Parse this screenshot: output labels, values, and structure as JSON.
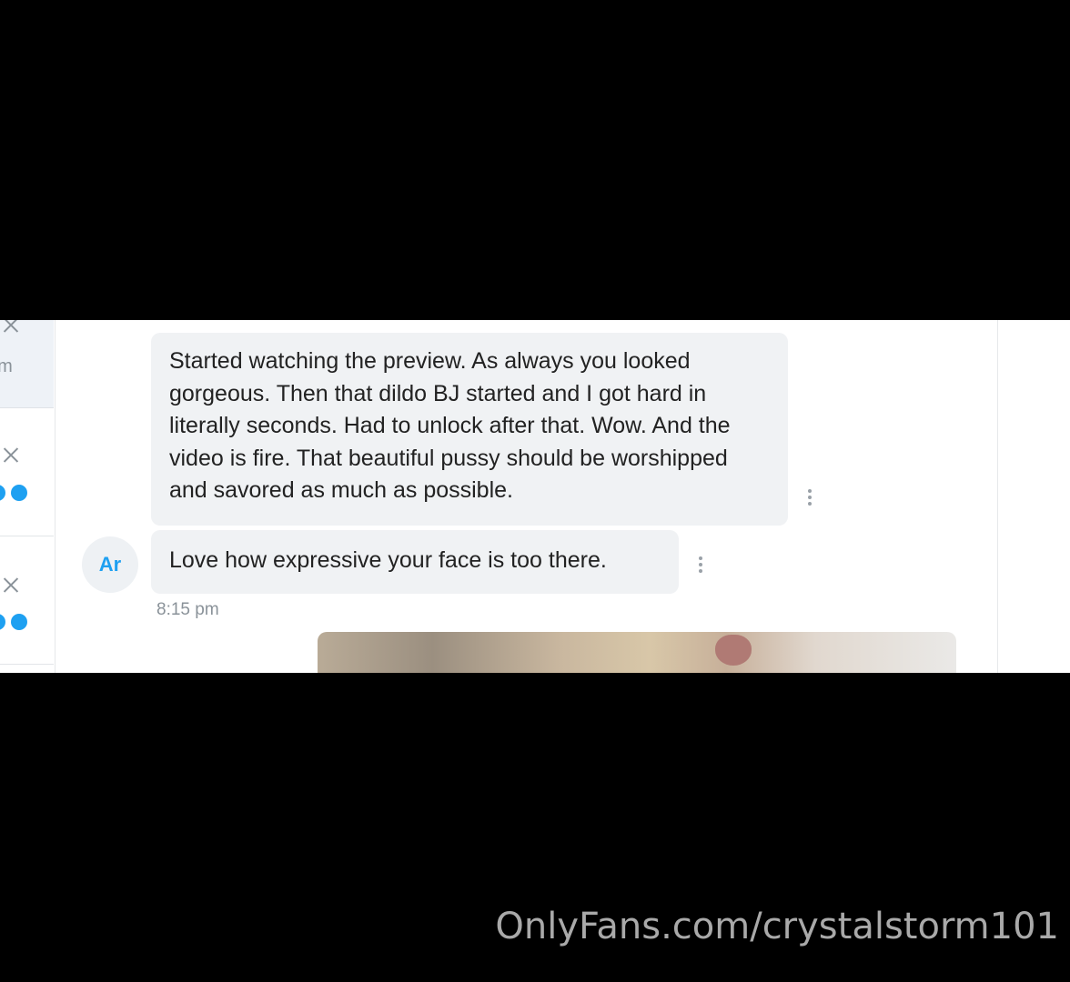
{
  "sidebar": {
    "partial_time": "am"
  },
  "messages": [
    {
      "text": "Started watching the preview. As always you looked gorgeous. Then that dildo BJ started and I got hard in literally seconds. Had to unlock after that. Wow. And the video is fire. That beautiful pussy should be worshipped and savored as much as possible."
    },
    {
      "text": "Love how expressive your face is too there."
    }
  ],
  "avatar_initials": "Ar",
  "timestamp": "8:15 pm",
  "watermark": "OnlyFans.com/crystalstorm101",
  "colors": {
    "accent": "#1ea0f1",
    "bubble": "#f0f2f4",
    "background": "#000000"
  }
}
